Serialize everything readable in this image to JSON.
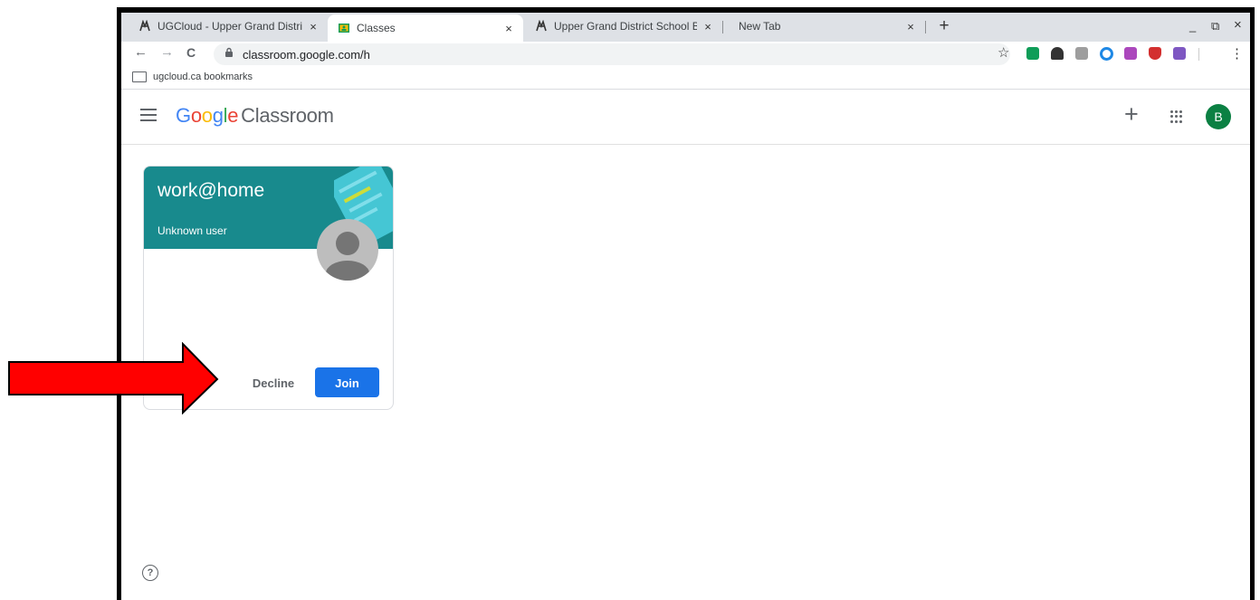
{
  "browser": {
    "tabs": [
      {
        "title": "UGCloud - Upper Grand District S",
        "close": "×"
      },
      {
        "title": "Classes",
        "close": "×"
      },
      {
        "title": "Upper Grand District School Boa",
        "close": "×"
      },
      {
        "title": "New Tab",
        "close": "×"
      }
    ],
    "new_tab": "+",
    "window_controls": {
      "minimize": "_",
      "restore": "⧉",
      "close": "×"
    },
    "nav": {
      "back": "←",
      "forward": "→",
      "reload": "C"
    },
    "url": "classroom.google.com/h",
    "star": "☆",
    "menu": "⋮",
    "bookmark": "ugcloud.ca bookmarks"
  },
  "app": {
    "brand": {
      "g1": "G",
      "o1": "o",
      "o2": "o",
      "g2": "g",
      "l": "l",
      "e": "e",
      "product": "Classroom"
    },
    "create": "+",
    "account_initial": "B"
  },
  "class_card": {
    "name": "work@home",
    "teacher": "Unknown user",
    "decline": "Decline",
    "join": "Join"
  },
  "help": "?",
  "colors": {
    "card_header": "#188a8d",
    "join_button": "#1a73e8",
    "avatar": "#0b8043",
    "arrow": "#ff0000"
  }
}
